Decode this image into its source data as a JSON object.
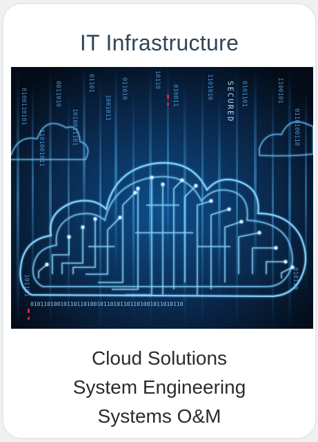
{
  "card": {
    "title": "IT Infrastructure",
    "image_alt": "cloud-circuit-image",
    "services": [
      "Cloud Solutions",
      "System Engineering",
      "Systems O&M"
    ],
    "image_text": "SECURED"
  },
  "colors": {
    "title": "#2f4558",
    "text": "#2b2b2b",
    "hero_dark": "#071526",
    "hero_glow": "#4fb6ff",
    "accent_red": "#e0242a"
  }
}
